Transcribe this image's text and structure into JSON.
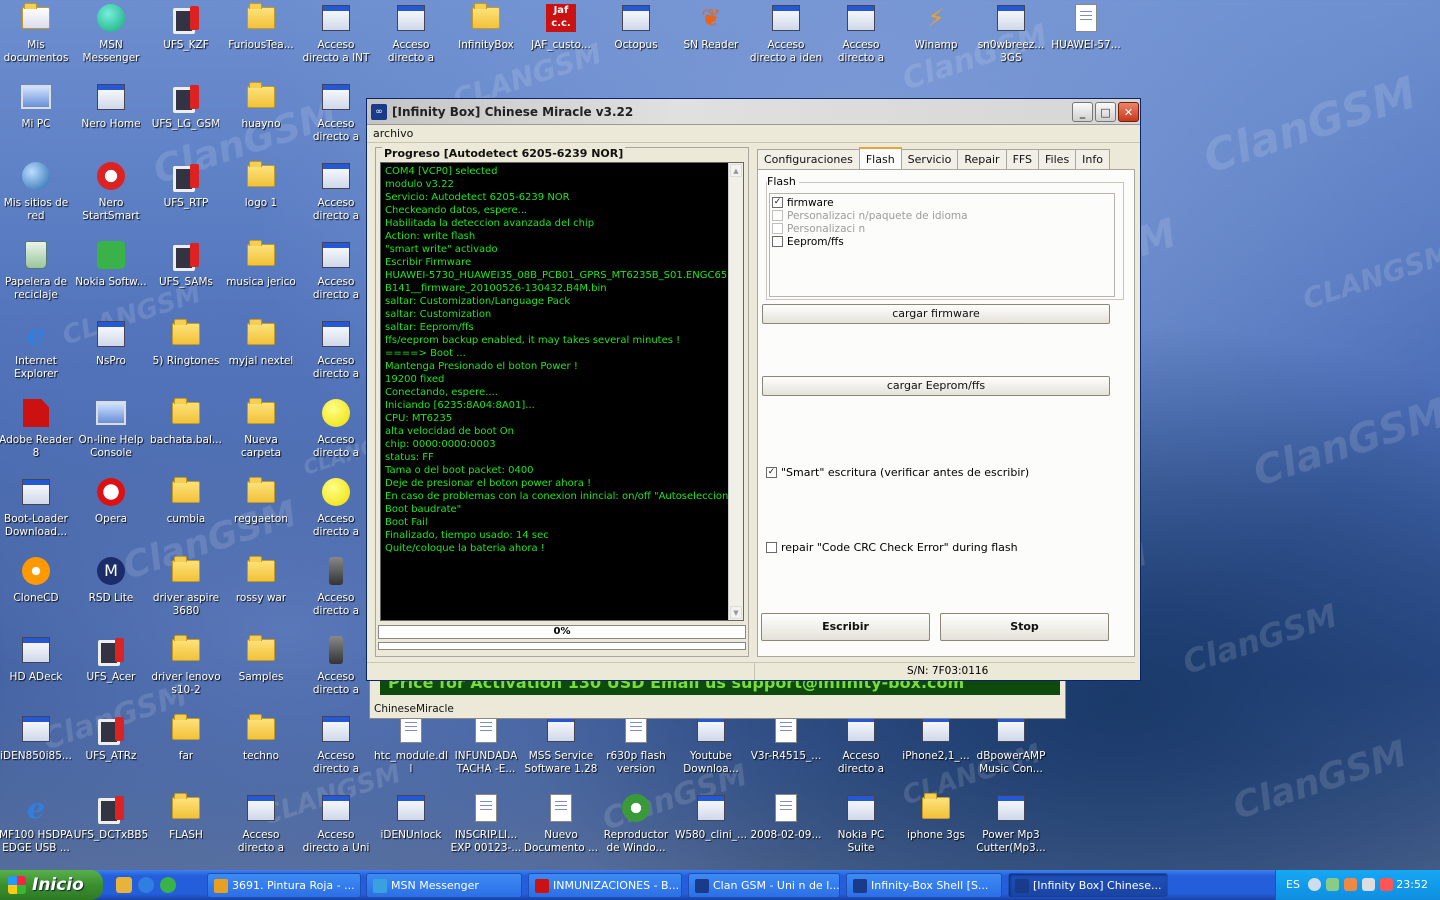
{
  "desktop": {
    "icons": [
      {
        "label": "Mis documentos",
        "kind": "docs"
      },
      {
        "label": "MSN Messenger 7.5",
        "kind": "msn"
      },
      {
        "label": "UFS_KZF",
        "kind": "ufs"
      },
      {
        "label": "FuriousTea...",
        "kind": "folder"
      },
      {
        "label": "Acceso directo a INT Lab U...",
        "kind": "exe"
      },
      {
        "label": "Acceso directo a Unibb5sl2ok",
        "kind": "exe"
      },
      {
        "label": "InfinityBox",
        "kind": "folder"
      },
      {
        "label": "JAF_custo...",
        "kind": "jaf"
      },
      {
        "label": "Octopus",
        "kind": "exe"
      },
      {
        "label": "SN Reader",
        "kind": "butterfly"
      },
      {
        "label": "Acceso directo a iden Depo...",
        "kind": "exe"
      },
      {
        "label": "Acceso directo a MotoRock...",
        "kind": "exe"
      },
      {
        "label": "Winamp",
        "kind": "winamp"
      },
      {
        "label": "sn0wbreez... 3GS",
        "kind": "exe"
      },
      {
        "label": "HUAWEI-57...",
        "kind": "doc"
      },
      {
        "label": "Mi PC",
        "kind": "pc"
      },
      {
        "label": "Nero Home",
        "kind": "exe"
      },
      {
        "label": "UFS_LG_GSM",
        "kind": "ufs"
      },
      {
        "label": "huayno",
        "kind": "folder"
      },
      {
        "label": "Acceso directo a LG_2_02S...",
        "kind": "exe"
      },
      {
        "label": "Mis sitios de red",
        "kind": "net"
      },
      {
        "label": "Nero StartSmart",
        "kind": "nero"
      },
      {
        "label": "UFS_RTP",
        "kind": "ufs"
      },
      {
        "label": "logo 1",
        "kind": "folder"
      },
      {
        "label": "Acceso directo a LGI_1_77S...",
        "kind": "exe"
      },
      {
        "label": "Papelera de reciclaje",
        "kind": "bin"
      },
      {
        "label": "Nokia Softw...",
        "kind": "nokia"
      },
      {
        "label": "UFS_SAMs",
        "kind": "ufs"
      },
      {
        "label": "musica jerico",
        "kind": "folder"
      },
      {
        "label": "Acceso directo a LGQ_1_4...",
        "kind": "exe"
      },
      {
        "label": "Internet Explorer",
        "kind": "ie"
      },
      {
        "label": "NsPro",
        "kind": "exe"
      },
      {
        "label": "5) Ringtones",
        "kind": "folder"
      },
      {
        "label": "myjal nextel",
        "kind": "folder"
      },
      {
        "label": "Acceso directo a ODM_Roc...",
        "kind": "exe"
      },
      {
        "label": "Adobe Reader 8",
        "kind": "adobe"
      },
      {
        "label": "On-line Help Console",
        "kind": "pc"
      },
      {
        "label": "bachata.bal...",
        "kind": "folder"
      },
      {
        "label": "Nueva carpeta",
        "kind": "folder"
      },
      {
        "label": "Acceso directo a optiflash",
        "kind": "smiley"
      },
      {
        "label": "Boot-Loader Download...",
        "kind": "exe"
      },
      {
        "label": "Opera",
        "kind": "opera"
      },
      {
        "label": "cumbia",
        "kind": "folder"
      },
      {
        "label": "reggaeton",
        "kind": "folder"
      },
      {
        "label": "Acceso directo a optiflash...",
        "kind": "smiley"
      },
      {
        "label": "CloneCD",
        "kind": "clone"
      },
      {
        "label": "RSD Lite",
        "kind": "moto"
      },
      {
        "label": "driver aspire 3680",
        "kind": "folder"
      },
      {
        "label": "rossy war",
        "kind": "folder"
      },
      {
        "label": "Acceso directo a Setool2g 1...",
        "kind": "phone"
      },
      {
        "label": "HD ADeck",
        "kind": "exe"
      },
      {
        "label": "UFS_Acer",
        "kind": "ufs"
      },
      {
        "label": "driver lenovo s10-2",
        "kind": "folder"
      },
      {
        "label": "Samples",
        "kind": "folder"
      },
      {
        "label": "Acceso directo a Setool2g 58",
        "kind": "phone"
      },
      {
        "label": "iDEN850i85...",
        "kind": "exe"
      },
      {
        "label": "UFS_ATRz",
        "kind": "ufs"
      },
      {
        "label": "far",
        "kind": "folder"
      },
      {
        "label": "techno",
        "kind": "folder"
      },
      {
        "label": "Acceso directo a supporter",
        "kind": "exe"
      },
      {
        "label": "htc_module.dll",
        "kind": "doc"
      },
      {
        "label": "INFUNDADA TACHA -E...",
        "kind": "doc"
      },
      {
        "label": "MSS Service Software 1.28",
        "kind": "exe"
      },
      {
        "label": "r630p flash version",
        "kind": "doc"
      },
      {
        "label": "Youtube Downloa...",
        "kind": "exe"
      },
      {
        "label": "V3r-R4515_...",
        "kind": "doc"
      },
      {
        "label": "Acceso directo a BBESCC1.2",
        "kind": "exe"
      },
      {
        "label": "iPhone2,1_...",
        "kind": "exe"
      },
      {
        "label": "dBpowerAMP Music Con...",
        "kind": "exe"
      },
      {
        "label": "MF100 HSDPA EDGE USB ...",
        "kind": "ie"
      },
      {
        "label": "UFS_DCTxBB5",
        "kind": "ufs"
      },
      {
        "label": "FLASH",
        "kind": "folder"
      },
      {
        "label": "Acceso directo a EGOLD_1...",
        "kind": "exe"
      },
      {
        "label": "Acceso directo a Uni para 1...",
        "kind": "exe"
      },
      {
        "label": "iDENUnlock",
        "kind": "exe"
      },
      {
        "label": "INSCRIP.LI... EXP 00123-...",
        "kind": "doc"
      },
      {
        "label": "Nuevo Documento ...",
        "kind": "doc"
      },
      {
        "label": "Reproductor de Windo...",
        "kind": "media"
      },
      {
        "label": "W580_clini_...",
        "kind": "exe"
      },
      {
        "label": "2008-02-09...",
        "kind": "doc"
      },
      {
        "label": "Nokia PC Suite",
        "kind": "exe"
      },
      {
        "label": "iphone 3gs",
        "kind": "folder"
      },
      {
        "label": "Power Mp3 Cutter(Mp3...",
        "kind": "exe"
      }
    ]
  },
  "window": {
    "title": "[Infinity Box] Chinese Miracle v3.22",
    "menu": "archivo",
    "progress_group_title": "Progreso [Autodetect 6205-6239 NOR]",
    "log_lines": [
      "COM4 [VCP0] selected",
      "modulo  v3.22",
      "Servicio: Autodetect 6205-6239 NOR",
      "Checkeando datos, espere...",
      "Habilitada la deteccion avanzada del chip",
      "Action: write flash",
      "\"smart write\" activado",
      "Escribir Firmware",
      "HUAWEI-5730_HUAWEI35_08B_PCB01_GPRS_MT6235B_S01.ENGC65",
      "B141__firmware_20100526-130432.B4M.bin",
      "saltar: Customization/Language Pack",
      "saltar: Customization",
      "saltar: Eeprom/ffs",
      "ffs/eeprom backup enabled, it may takes several minutes !",
      "====> Boot ...",
      "Mantenga Presionado el boton Power !",
      "19200 fixed",
      "Conectando, espere....",
      "Iniciando [6235:8A04:8A01]...",
      "CPU: MT6235",
      "alta velocidad de boot On",
      "chip: 0000:0000:0003",
      "status: FF",
      "Tama o del boot packet: 0400",
      "Deje de presionar el boton power ahora !",
      "En caso de problemas con la conexion inincial: on/off \"Autoseleccionar",
      "Boot baudrate\"",
      "Boot Fail",
      "Finalizado, tiempo usado: 14 sec",
      "Quite/coloque la bateria ahora !"
    ],
    "progress_percent": 0,
    "progress_label": "0%",
    "tabs": [
      "Configuraciones",
      "Flash",
      "Servicio",
      "Repair",
      "FFS",
      "Files",
      "Info"
    ],
    "active_tab": "Flash",
    "flash_group_label": "Flash",
    "flash_items": [
      {
        "label": "firmware",
        "checked": true,
        "enabled": true
      },
      {
        "label": "Personalizaci n/paquete de idioma",
        "checked": false,
        "enabled": false
      },
      {
        "label": "Personalizaci n",
        "checked": false,
        "enabled": false
      },
      {
        "label": "Eeprom/ffs",
        "checked": false,
        "enabled": true
      }
    ],
    "load_firmware_button": "cargar firmware",
    "load_eeprom_button": "cargar Eeprom/ffs",
    "smart_write_label": "\"Smart\" escritura (verificar antes de escribir)",
    "smart_write_checked": true,
    "repair_crc_label": "repair \"Code CRC Check Error\" during flash",
    "repair_crc_checked": false,
    "write_button": "Escribir",
    "stop_button": "Stop",
    "serial": "S/N: 7F03:0116"
  },
  "back_window": {
    "banner_text": "Price for Activation 130 USD  Email us support@infinity-box.com",
    "status_text": "ChineseMiracle"
  },
  "taskbar": {
    "start_label": "Inicio",
    "tasks": [
      {
        "label": "3691. Pintura Roja - ...",
        "color": "#e8a020"
      },
      {
        "label": "MSN Messenger",
        "color": "#3aa0e0"
      },
      {
        "label": "INMUNIZACIONES - B...",
        "color": "#cc1111"
      },
      {
        "label": "Clan GSM - Uni n de l...",
        "color": "#1a3a8a"
      },
      {
        "label": "Infinity-Box Shell   [S...",
        "color": "#1a3a8a"
      },
      {
        "label": "[Infinity Box] Chinese...",
        "color": "#1a3a8a"
      }
    ],
    "active_task": 5,
    "language": "ES",
    "clock": "23:52"
  },
  "watermark_text": "ClanGSM",
  "watermark_text_small": "CLANGSM.COM",
  "watermark_text_caps": "CLANGSM"
}
